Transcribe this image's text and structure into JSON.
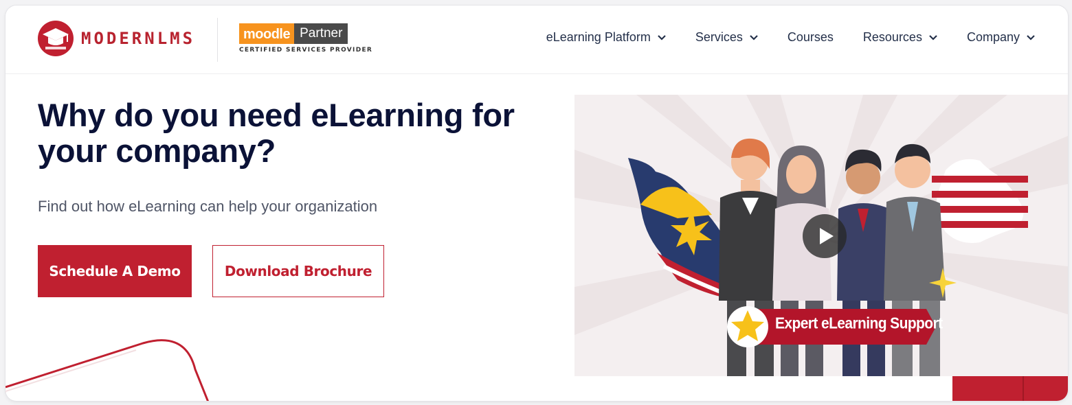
{
  "brand": {
    "logo_word": "MODERNLMS",
    "logo_icon": "graduation-cap-icon",
    "brand_color": "#c02030"
  },
  "partner_badge": {
    "moodle": "moodle",
    "partner": "Partner",
    "subtitle": "CERTIFIED SERVICES PROVIDER"
  },
  "nav": {
    "items": [
      {
        "label": "eLearning Platform",
        "dropdown": true
      },
      {
        "label": "Services",
        "dropdown": true
      },
      {
        "label": "Courses",
        "dropdown": false
      },
      {
        "label": "Resources",
        "dropdown": true
      },
      {
        "label": "Company",
        "dropdown": true
      }
    ]
  },
  "hero": {
    "title_line1": "Why do you need eLearning for",
    "title_line2": "your company?",
    "subtitle": "Find out how eLearning can help your organization",
    "primary_cta": "Schedule A Demo",
    "secondary_cta": "Download Brochure"
  },
  "video": {
    "banner_text": "Expert eLearning Support",
    "play_icon": "play-icon",
    "star_icon": "star-icon"
  }
}
